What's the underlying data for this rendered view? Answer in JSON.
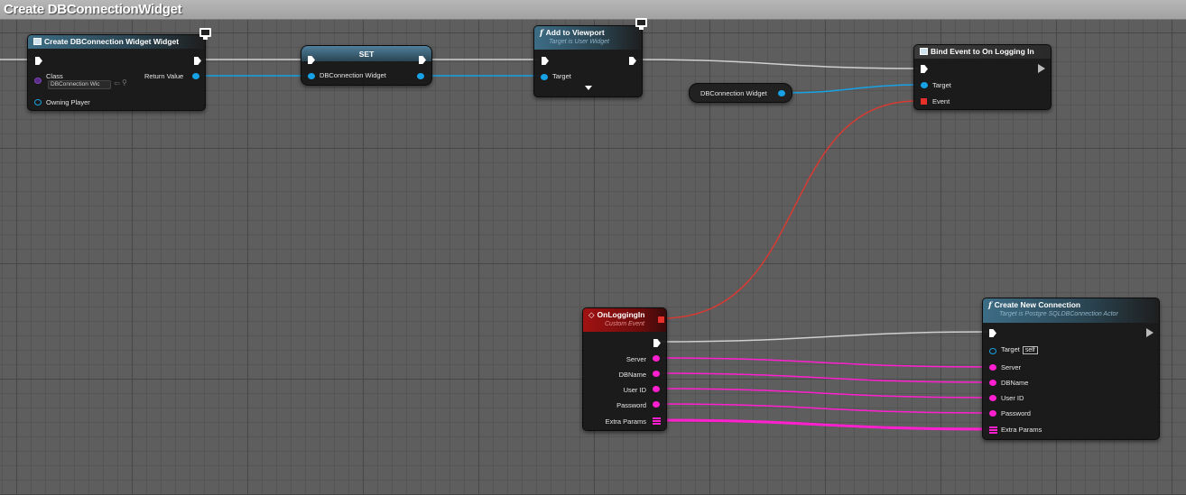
{
  "window": {
    "title": "Create DBConnectionWidget"
  },
  "nodes": {
    "create_widget": {
      "title": "Create DBConnection Widget Widget",
      "class_label": "Class",
      "class_value": "DBConnection Wic",
      "return_label": "Return Value",
      "owning_label": "Owning Player"
    },
    "set": {
      "title": "SET",
      "pin_label": "DBConnection Widget"
    },
    "add_viewport": {
      "title": "Add to Viewport",
      "subtitle": "Target is User Widget",
      "target_label": "Target"
    },
    "db_var": {
      "label": "DBConnection Widget"
    },
    "bind_event": {
      "title": "Bind Event to On Logging In",
      "target_label": "Target",
      "event_label": "Event"
    },
    "on_logging_in": {
      "title": "OnLoggingIn",
      "subtitle": "Custom Event",
      "pins": [
        "Server",
        "DBName",
        "User ID",
        "Password",
        "Extra Params"
      ]
    },
    "create_connection": {
      "title": "Create New Connection",
      "subtitle": "Target is Postgre SQLDBConnection Actor",
      "target_label": "Target",
      "target_value": "self",
      "pins": [
        "Server",
        "DBName",
        "User ID",
        "Password",
        "Extra Params"
      ]
    }
  },
  "colors": {
    "exec": "#ffffff",
    "object": "#17a2e6",
    "string": "#ff1fcf",
    "delegate": "#e8302a",
    "class": "#5b2a8a"
  }
}
